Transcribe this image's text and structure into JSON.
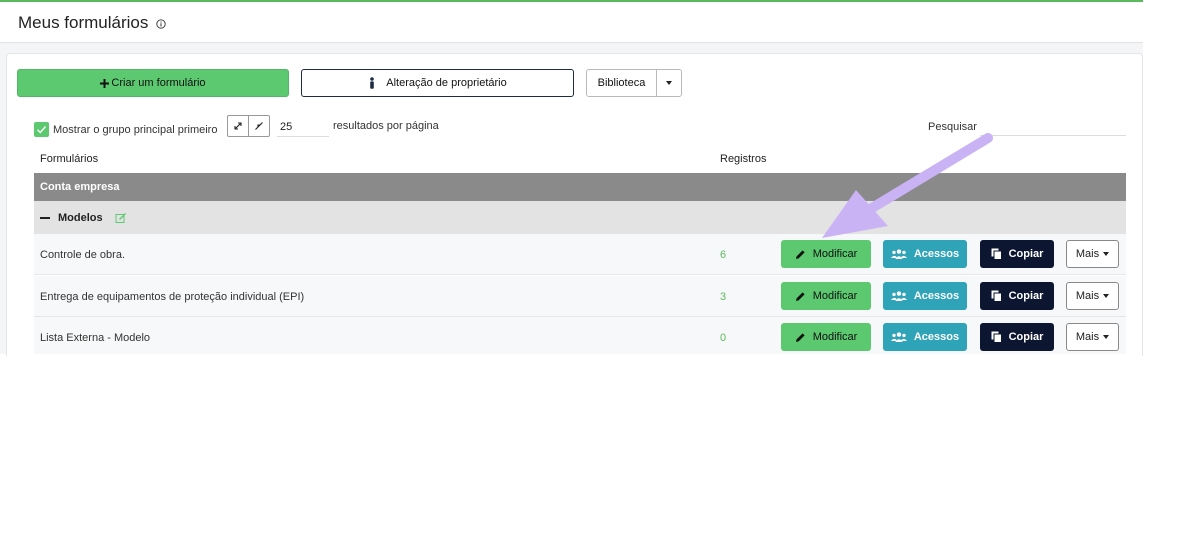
{
  "header": {
    "title": "Meus formulários",
    "info_icon": "info-circle-icon"
  },
  "toolbar": {
    "create_label": "Criar um formulário",
    "owner_label": "Alteração de proprietário",
    "library_label": "Biblioteca"
  },
  "controls": {
    "show_main_group_label": "Mostrar o grupo principal primeiro",
    "show_main_group_checked": true,
    "per_page_value": "25",
    "per_page_label": "resultados por página",
    "search_label": "Pesquisar",
    "search_value": ""
  },
  "table": {
    "columns": [
      "Formulários",
      "Registros"
    ],
    "group": "Conta empresa",
    "subgroup": "Modelos",
    "rows": [
      {
        "name": "Controle de obra.",
        "count": "6"
      },
      {
        "name": "Entrega de equipamentos de proteção individual (EPI)",
        "count": "3"
      },
      {
        "name": "Lista Externa - Modelo",
        "count": "0"
      }
    ],
    "actions": {
      "modify": "Modificar",
      "access": "Acessos",
      "copy": "Copiar",
      "more": "Mais"
    }
  },
  "colors": {
    "primary_green": "#5cc870",
    "teal": "#2fa3b8",
    "navy": "#0c1631",
    "group_gray": "#8a8a8a",
    "annotation_arrow": "#c9b3f5"
  }
}
